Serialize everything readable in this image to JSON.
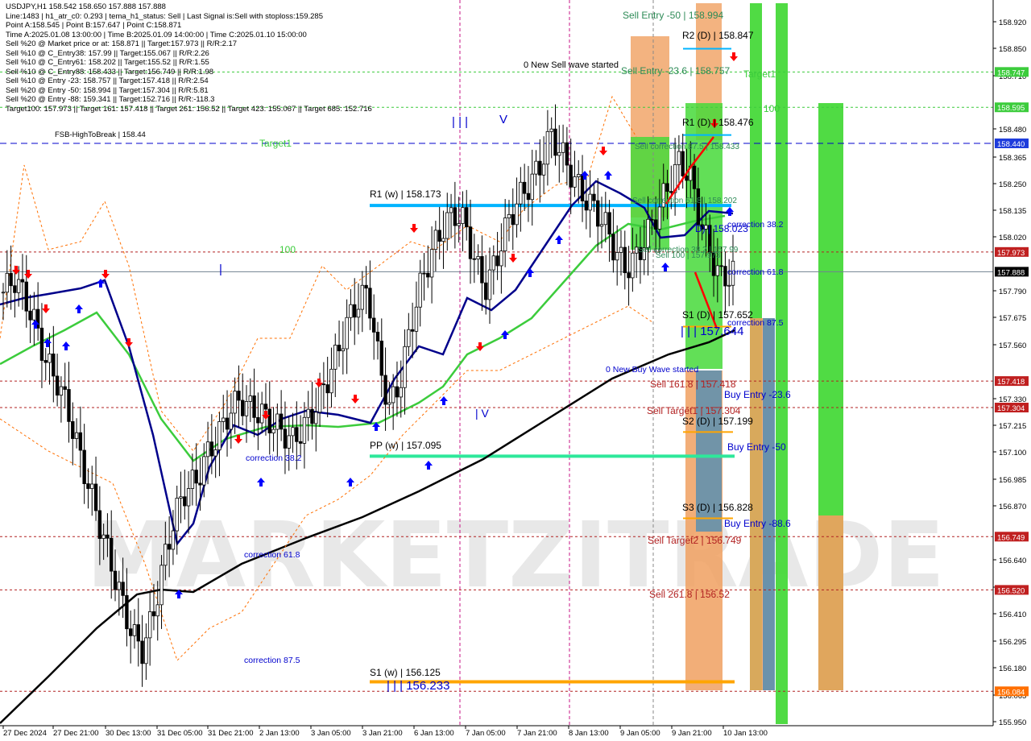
{
  "header": {
    "lines": [
      "USDJPY,H1  158.542 158.650 157.888 157.888",
      "Line:1483  |  h1_atr_c0: 0.293  |  tema_h1_status: Sell  |  Last Signal is:Sell with stoploss:159.285",
      "Point A:158.545  |  Point B:157.647  |  Point C:158.871",
      "Time A:2025.01.08 13:00:00  |  Time B:2025.01.09 14:00:00  |  Time C:2025.01.10 15:00:00",
      "Sell %20 @ Market price or at: 158.871  ||  Target:157.973  ||  R/R:2.17",
      "Sell %10 @ C_Entry38: 157.99  ||  Target:155.067  ||  R/R:2.26",
      "Sell %10 @ C_Entry61: 158.202  ||  Target:155.52  ||  R/R:1.55",
      "Sell %10 @ C_Entry88: 158.433  ||  Target:156.749  ||  R/R:1.98",
      "Sell %10 @ Entry -23: 158.757  ||  Target:157.418  ||  R/R:2.54",
      "Sell %20 @ Entry -50: 158.994  ||  Target:157.304  ||  R/R:5.81",
      "Sell %20 @ Entry -88: 159.341  ||  Target:152.716  ||  R/R:-118.3",
      "Target100: 157.973  ||  Target 161: 157.418  ||  Target 261: 156.52  ||  Target 423: 155.067  ||  Target 685: 152.716"
    ]
  },
  "watermark": "MARKETZITRADE",
  "colors": {
    "candle": "#000000",
    "tema_blue": "#00008b",
    "ma_green": "#3ccc3c",
    "ma200_black": "#000000",
    "buy_arrow": "#0000ff",
    "sell_arrow": "#ff0000",
    "dashed_red": "#b22222",
    "orange_line": "#ff6f00",
    "pivot_blue": "#00b4ff",
    "pivot_green": "#2ee89a",
    "pivot_orange": "#ffa500",
    "box_orange": "#f0a060",
    "box_green": "#47d93a",
    "box_blue": "#5b8fb0"
  },
  "chart_data": {
    "type": "candlestick",
    "symbol": "USDJPY",
    "timeframe": "H1",
    "ylim": [
      155.95,
      158.994
    ],
    "x_ticks": [
      "27 Dec 2024",
      "27 Dec 21:00",
      "30 Dec 13:00",
      "31 Dec 05:00",
      "31 Dec 21:00",
      "2 Jan 13:00",
      "3 Jan 05:00",
      "3 Jan 21:00",
      "6 Jan 13:00",
      "7 Jan 05:00",
      "7 Jan 21:00",
      "8 Jan 13:00",
      "9 Jan 05:00",
      "9 Jan 21:00",
      "10 Jan 13:00"
    ],
    "y_ticks": [
      "158.920",
      "158.850",
      "158.710",
      "158.480",
      "158.365",
      "158.250",
      "158.135",
      "158.020",
      "157.790",
      "157.675",
      "157.560",
      "157.330",
      "157.215",
      "157.100",
      "156.985",
      "156.870",
      "156.640",
      "156.525",
      "156.410",
      "156.295",
      "156.180",
      "156.065",
      "155.950"
    ],
    "price_boxes": [
      {
        "label": "158.747",
        "value": 158.747,
        "bg": "#3ccc3c"
      },
      {
        "label": "158.595",
        "value": 158.595,
        "bg": "#3ccc3c"
      },
      {
        "label": "158.440",
        "value": 158.44,
        "bg": "#1e3cdc"
      },
      {
        "label": "157.973",
        "value": 157.973,
        "bg": "#c02020"
      },
      {
        "label": "157.888",
        "value": 157.888,
        "bg": "#000000"
      },
      {
        "label": "157.418",
        "value": 157.418,
        "bg": "#c02020"
      },
      {
        "label": "157.304",
        "value": 157.304,
        "bg": "#c02020"
      },
      {
        "label": "156.749",
        "value": 156.749,
        "bg": "#c02020"
      },
      {
        "label": "156.520",
        "value": 156.52,
        "bg": "#c02020"
      },
      {
        "label": "156.084",
        "value": 156.084,
        "bg": "#ff6f00"
      }
    ],
    "levels": [
      {
        "label": "FSB-HighToBreak | 158.44",
        "value": 158.44,
        "color": "#0000cd",
        "style": "dashed"
      },
      {
        "label": "R1 (w) | 158.173",
        "value": 158.173,
        "color": "#00b4ff"
      },
      {
        "label": "PP (w) | 157.095",
        "value": 157.095,
        "color": "#2ee89a"
      },
      {
        "label": "S1 (w) | 156.125",
        "value": 156.125,
        "color": "#ffa500"
      },
      {
        "label": "R2 (D) | 158.847",
        "value": 158.847
      },
      {
        "label": "R1 (D) | 158.476",
        "value": 158.476
      },
      {
        "label": "S1 (D) | 157.652",
        "value": 157.652
      },
      {
        "label": "S2 (D) | 157.199",
        "value": 157.199
      },
      {
        "label": "S3 (D) | 156.828",
        "value": 156.828
      }
    ],
    "annotations": [
      "Sell Entry -50 | 158.994",
      "Sell Entry -23.6 | 158.757",
      "0 New Sell wave started",
      "Target1",
      "Target1",
      "100",
      "100",
      "Sell correction 87.5 | 158.433",
      "Sell correction 61.8 | 158.202",
      "Sell correction 38.2 | 157.99",
      "Sell 100 | 157.973",
      "correction 38.2",
      "correction 61.8",
      "correction 87.5",
      "| | | 157.644",
      "0 New Buy Wave started",
      "Sell 161.8 | 157.418",
      "Sell Target1 | 157.304",
      "Buy Entry -23.6",
      "Buy Entry -50",
      "Buy Entry -88.6",
      "Sell Target2 | 156.749",
      "Sell 261.8 | 156.52",
      "| | | 156.233",
      "correction 38.2",
      "correction 61.8",
      "correction 87.5",
      "| | |",
      "V",
      "| V",
      "|",
      "D) | 158.023"
    ],
    "close": [
      157.8,
      157.86,
      157.78,
      157.66,
      157.5,
      157.42,
      157.3,
      157.12,
      156.96,
      156.8,
      156.64,
      156.48,
      156.33,
      156.26,
      156.42,
      156.65,
      156.84,
      156.95,
      156.99,
      157.1,
      157.18,
      157.28,
      157.34,
      157.3,
      157.28,
      157.24,
      157.2,
      157.16,
      157.22,
      157.3,
      157.4,
      157.52,
      157.66,
      157.76,
      157.8,
      157.5,
      157.3,
      157.42,
      157.66,
      157.85,
      157.98,
      158.08,
      158.14,
      158.1,
      157.92,
      157.82,
      157.95,
      158.1,
      158.2,
      158.26,
      158.34,
      158.48,
      158.4,
      158.3,
      158.22,
      158.16,
      158.1,
      157.98,
      157.9,
      157.95,
      158.05,
      158.15,
      158.26,
      158.36,
      158.3,
      158.1,
      157.95,
      157.85,
      157.888
    ]
  }
}
